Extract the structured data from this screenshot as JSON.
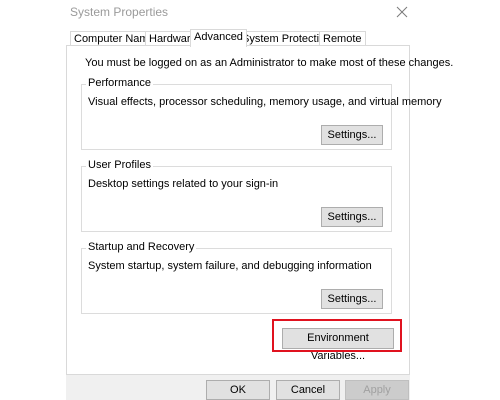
{
  "window": {
    "title": "System Properties"
  },
  "tabs": [
    {
      "label": "Computer Name"
    },
    {
      "label": "Hardware"
    },
    {
      "label": "Advanced"
    },
    {
      "label": "System Protection"
    },
    {
      "label": "Remote"
    }
  ],
  "active_tab": "Advanced",
  "notice": "You must be logged on as an Administrator to make most of these changes.",
  "groups": {
    "performance": {
      "title": "Performance",
      "description": "Visual effects, processor scheduling, memory usage, and virtual memory",
      "button": "Settings..."
    },
    "user_profiles": {
      "title": "User Profiles",
      "description": "Desktop settings related to your sign-in",
      "button": "Settings..."
    },
    "startup_recovery": {
      "title": "Startup and Recovery",
      "description": "System startup, system failure, and debugging information",
      "button": "Settings..."
    }
  },
  "environment_button": "Environment Variables...",
  "dialog_buttons": {
    "ok": "OK",
    "cancel": "Cancel",
    "apply": "Apply"
  },
  "icons": {
    "close": "close-icon"
  },
  "colors": {
    "highlight": "#e0121f",
    "title_text": "#9a9a9a",
    "button_face": "#e1e1e1",
    "button_border": "#adadad",
    "disabled_text": "#a0a0a0"
  }
}
